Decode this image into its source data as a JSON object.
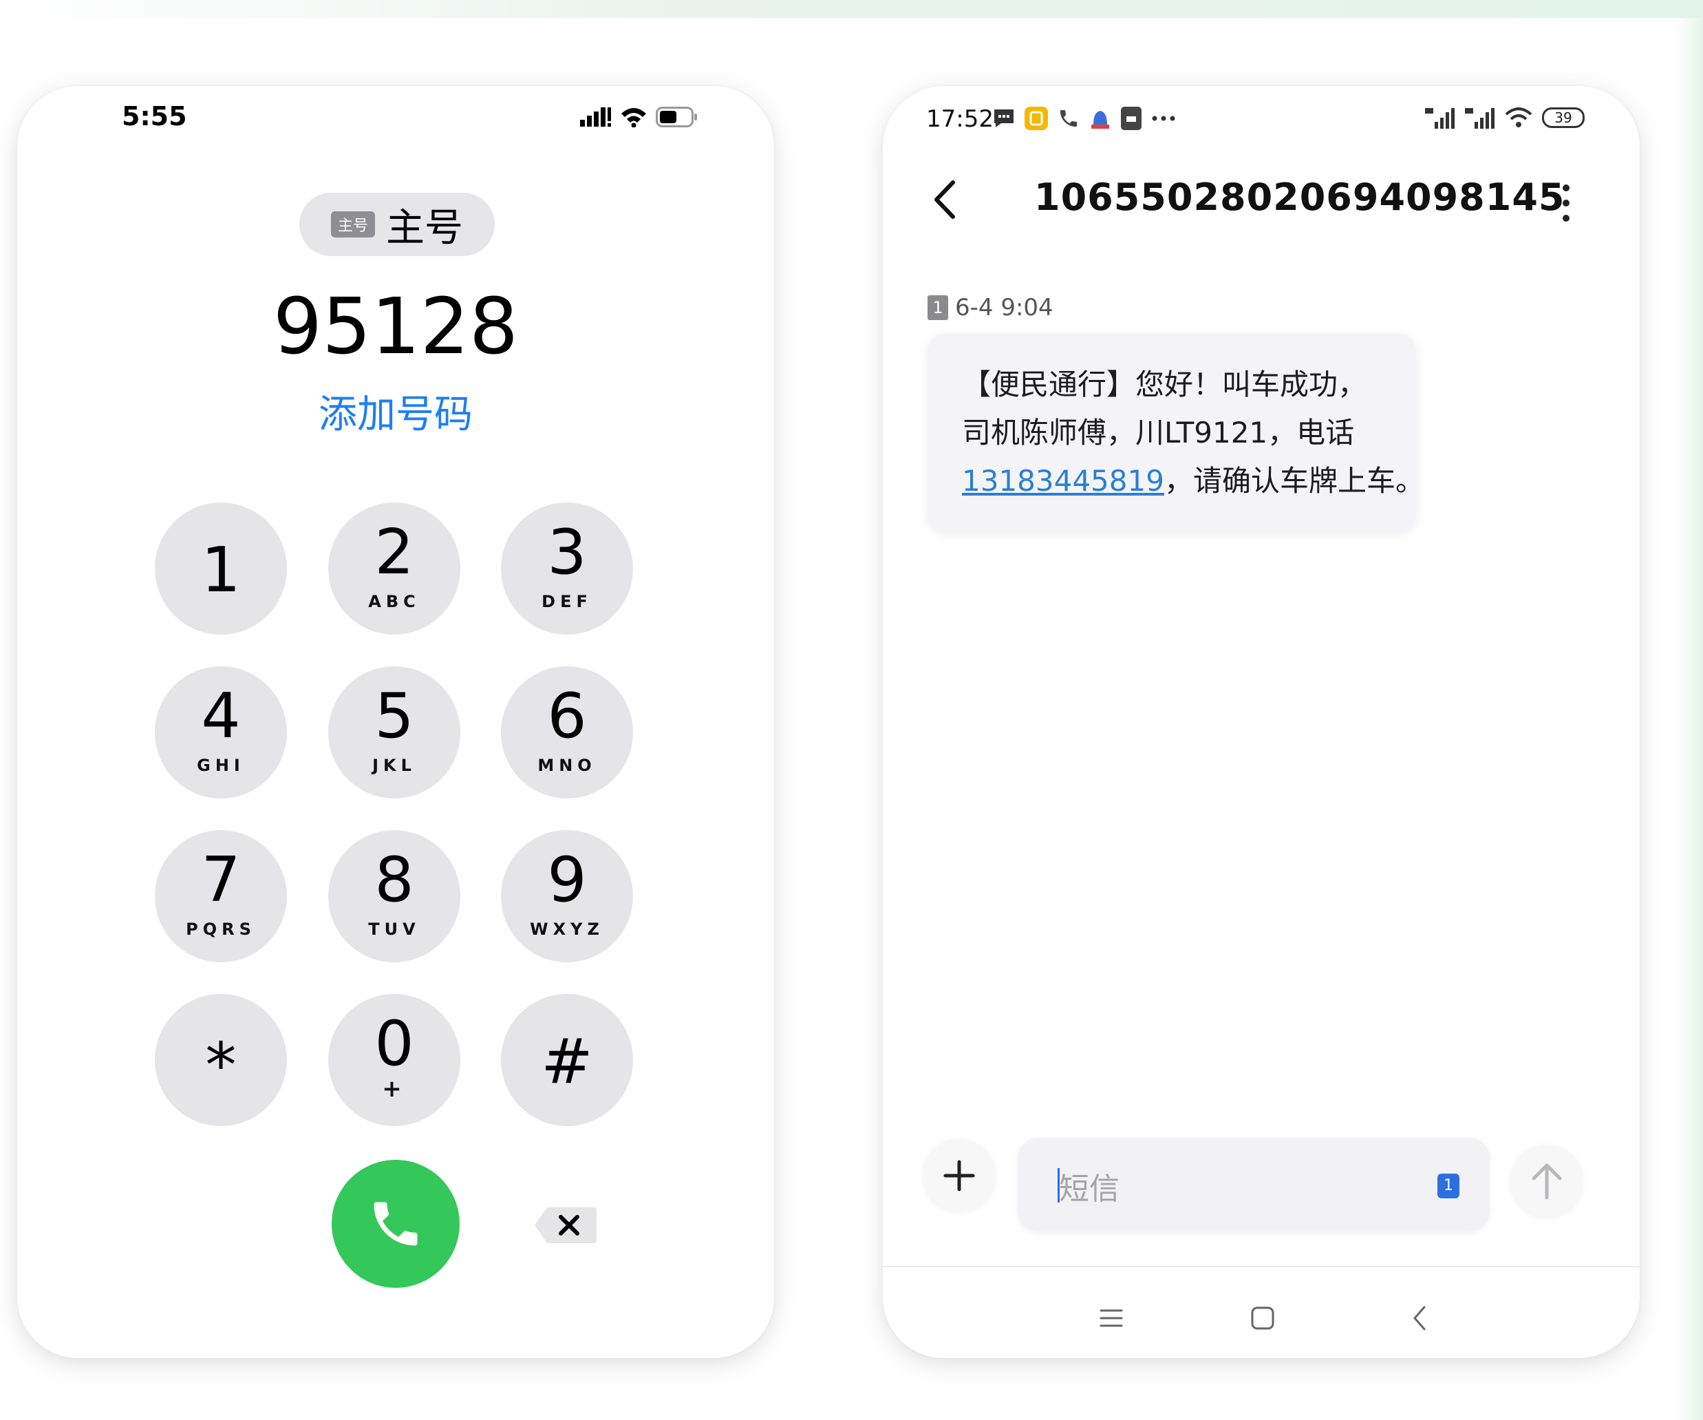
{
  "dialer": {
    "time": "5:55",
    "sim_tag": "主号",
    "sim_label": "主号",
    "number": "95128",
    "add_number": "添加号码",
    "keys": [
      {
        "digit": "1",
        "letters": ""
      },
      {
        "digit": "2",
        "letters": "ABC"
      },
      {
        "digit": "3",
        "letters": "DEF"
      },
      {
        "digit": "4",
        "letters": "GHI"
      },
      {
        "digit": "5",
        "letters": "JKL"
      },
      {
        "digit": "6",
        "letters": "MNO"
      },
      {
        "digit": "7",
        "letters": "PQRS"
      },
      {
        "digit": "8",
        "letters": "TUV"
      },
      {
        "digit": "9",
        "letters": "WXYZ"
      },
      {
        "digit": "*",
        "letters": ""
      },
      {
        "digit": "0",
        "letters": "+"
      },
      {
        "digit": "#",
        "letters": ""
      }
    ],
    "call_color": "#34c759",
    "link_color": "#1f7ef0"
  },
  "sms": {
    "time": "17:52",
    "battery": "39",
    "sender": "1065502802069409814​5",
    "sim_index": "1",
    "message_time": "6-4 9:04",
    "message": {
      "line1": "【便民通行】您好！叫车成功，",
      "line2": "司机陈师傅，川LT9121，电话",
      "line3_link": "13183445819",
      "line3_rest": "，请确认车牌上车。"
    },
    "input_placeholder": "短信",
    "input_sim": "1"
  }
}
